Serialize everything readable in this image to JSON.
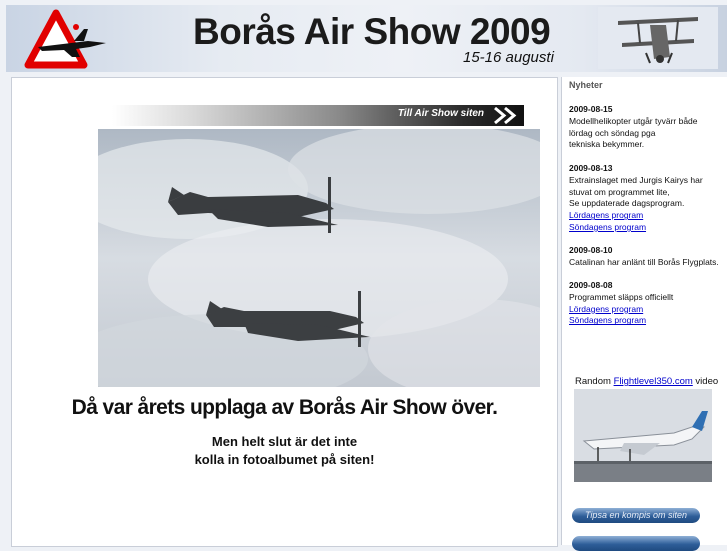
{
  "header": {
    "title": "Borås Air Show 2009",
    "dates": "15-16 augusti"
  },
  "main": {
    "air_show_link": "Till Air Show siten",
    "headline": "Då var årets upplaga av Borås Air Show över.",
    "subline1": "Men helt slut är det inte",
    "subline2": "kolla in fotoalbumet på siten!"
  },
  "sidebar": {
    "heading": "Nyheter",
    "news": [
      {
        "date": "2009-08-15",
        "lines": [
          "Modellhelikopter utgår tyvärr både",
          "lördag och söndag pga",
          "tekniska bekymmer."
        ],
        "links": []
      },
      {
        "date": "2009-08-13",
        "lines": [
          "Extrainslaget med Jurgis Kairys har",
          "stuvat om programmet lite,",
          "Se uppdaterade dagsprogram."
        ],
        "links": [
          "Lördagens program",
          "Söndagens program"
        ]
      },
      {
        "date": "2009-08-10",
        "lines": [
          "Catalinan har anlänt till Borås Flygplats."
        ],
        "links": []
      },
      {
        "date": "2009-08-08",
        "lines": [
          "Programmet släpps officiellt"
        ],
        "links": [
          "Lördagens program",
          "Söndagens program"
        ]
      }
    ],
    "video": {
      "prefix": "Random",
      "link": "Flightlevel350.com",
      "suffix": "video"
    },
    "buttons": {
      "tips": "Tipsa en kompis om siten"
    }
  },
  "colors": {
    "link": "#0000cc",
    "button": "#2e5e99",
    "warning_sign": "#e10000"
  }
}
